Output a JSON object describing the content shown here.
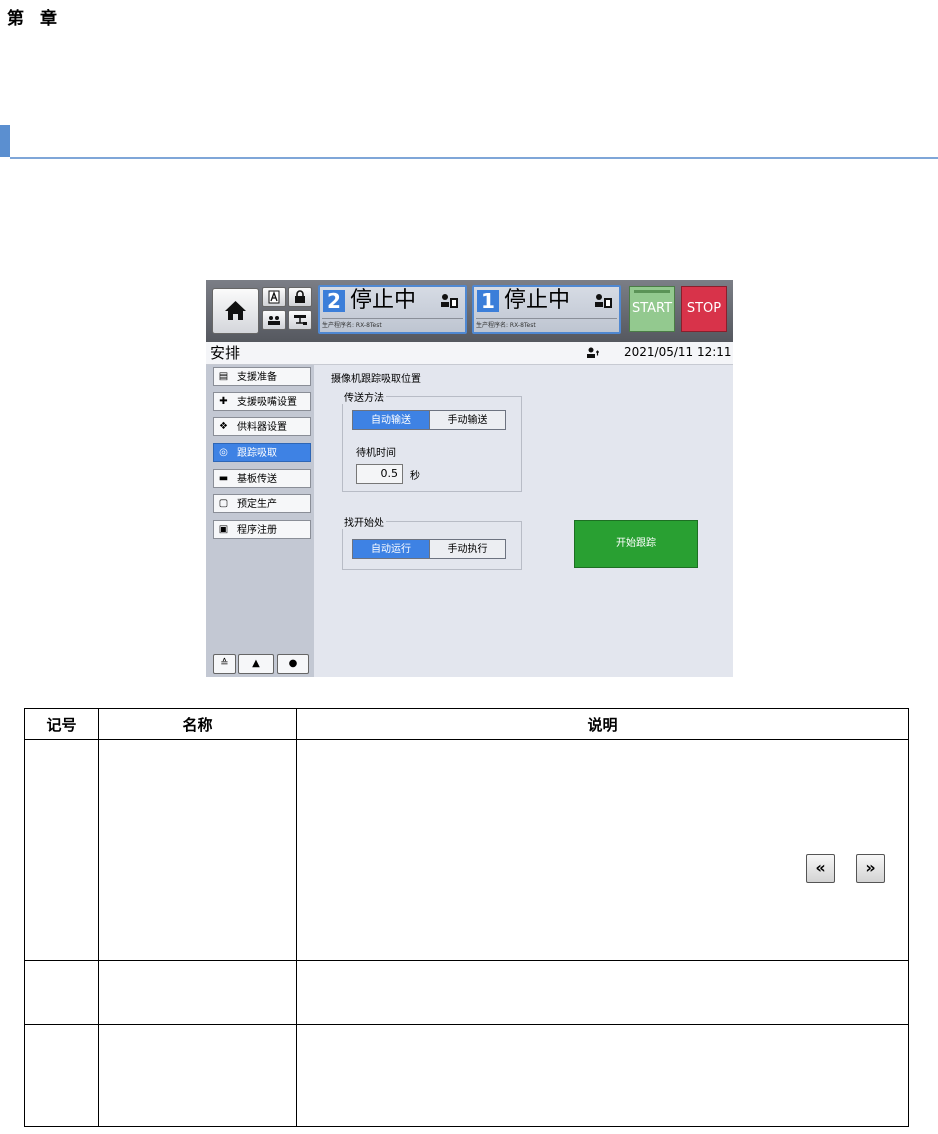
{
  "doc": {
    "chapter": [
      "第",
      "章"
    ]
  },
  "screen": {
    "status": [
      {
        "num": "2",
        "text": "停止中",
        "program": "生产程序名: RX-8Test"
      },
      {
        "num": "1",
        "text": "停止中",
        "program": "生产程序名: RX-8Test"
      }
    ],
    "start_label": "START",
    "stop_label": "STOP",
    "title": "安排",
    "datetime": "2021/05/11 12:11",
    "sidebar": [
      {
        "label": "支援准备",
        "icon": "support-prep-icon",
        "active": false
      },
      {
        "label": "支援吸嘴设置",
        "icon": "nozzle-icon",
        "active": false
      },
      {
        "label": "供料器设置",
        "icon": "feeder-icon",
        "active": false
      },
      {
        "label": "跟踪吸取",
        "icon": "tracking-icon",
        "active": true
      },
      {
        "label": "基板传送",
        "icon": "board-transfer-icon",
        "active": false
      },
      {
        "label": "预定生产",
        "icon": "schedule-icon",
        "active": false
      },
      {
        "label": "程序注册",
        "icon": "program-register-icon",
        "active": false
      }
    ],
    "main_title": "摄像机跟踪吸取位置",
    "transfer": {
      "label": "传送方法",
      "auto": "自动输送",
      "manual": "手动输送",
      "wait_label": "待机时间",
      "wait_value": "0.5",
      "wait_unit": "秒"
    },
    "find_start": {
      "label": "找开始处",
      "auto": "自动运行",
      "manual": "手动执行"
    },
    "start_tracking": "开始跟踪",
    "colors": {
      "accent": "#3e82e4",
      "go": "#29a032",
      "stop": "#d8334a",
      "start": "#93c98f"
    }
  },
  "table": {
    "headers": [
      "记号",
      "名称",
      "说明"
    ],
    "nav_prev": "«",
    "nav_next": "»"
  }
}
